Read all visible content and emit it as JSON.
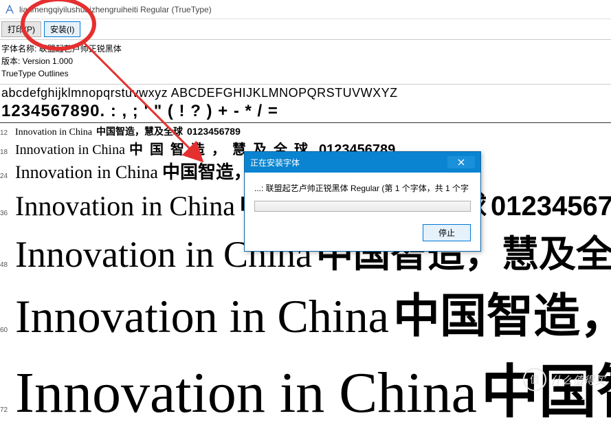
{
  "title": "lianmengqiyilushuaizhengruiheiti Regular (TrueType)",
  "toolbar": {
    "print_label": "打印(P)",
    "install_label": "安装(I)"
  },
  "meta": {
    "font_name_label": "字体名称:",
    "font_name": "联盟起艺卢帅正锐黑体",
    "version": "版本: Version 1.000",
    "outlines": "TrueType Outlines"
  },
  "glyphs": {
    "alpha": "abcdefghijklmnopqrstuvwxyz ABCDEFGHIJKLMNOPQRSTUVWXYZ",
    "nums": "1234567890. : , ; ' \" ( ! ? ) + - * / ="
  },
  "sample_sizes": [
    "12",
    "18",
    "24",
    "36",
    "48",
    "60",
    "72"
  ],
  "sample_en": "Innovation in China",
  "sample_cn": "中国智造，慧及全球",
  "sample_digits": "0123456789",
  "dialog": {
    "title": "正在安装字体",
    "body": "...: 联盟起艺卢帅正锐黑体 Regular (第 1 个字体，共 1 个字",
    "stop": "停止"
  },
  "watermark": {
    "badge": "值",
    "text": "什么值得买"
  }
}
